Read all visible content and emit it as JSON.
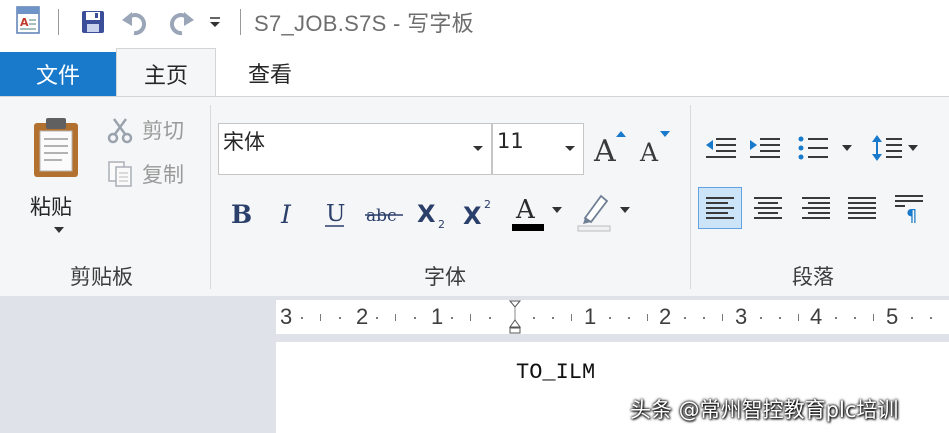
{
  "title_bar": {
    "title": "S7_JOB.S7S - 写字板",
    "app_icon": "wordpad-icon",
    "save_icon": "save-icon",
    "undo_icon": "undo-icon",
    "redo_icon": "redo-icon",
    "customize_icon": "customize-quick-access-icon"
  },
  "tabs": {
    "file": "文件",
    "home": "主页",
    "view": "查看"
  },
  "clipboard": {
    "paste": "粘贴",
    "cut": "剪切",
    "copy": "复制",
    "group_label": "剪贴板"
  },
  "font": {
    "family": "宋体",
    "size": "11",
    "group_label": "字体",
    "text_color": "#000000"
  },
  "paragraph": {
    "group_label": "段落"
  },
  "ruler": {
    "labels": [
      "3",
      "2",
      "1",
      "1",
      "2",
      "3",
      "4",
      "5"
    ]
  },
  "document": {
    "text": "TO_ILM"
  },
  "watermark": {
    "text": "头条 @常州智控教育plc培训"
  },
  "colors": {
    "file_tab": "#1979ca",
    "ribbon_bg": "#f5f6f7",
    "workspace_bg": "#dfe3e9",
    "active_toggle_bg": "#cce4f7"
  }
}
